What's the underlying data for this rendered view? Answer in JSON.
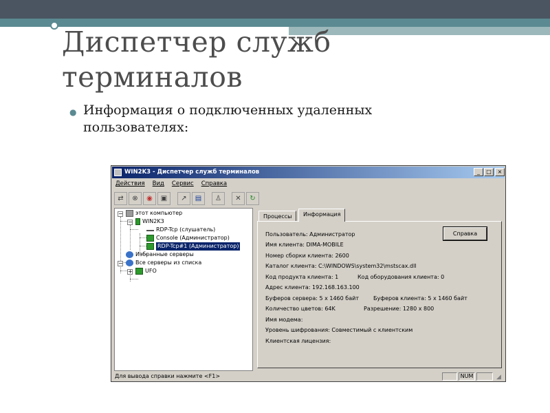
{
  "slide": {
    "title": "Диспетчер служб терминалов",
    "bullet": "Информация о подключенных удаленных пользователях:"
  },
  "window": {
    "title": "WIN2K3 - Диспетчер служб терминалов",
    "controls": {
      "minimize": "_",
      "maximize": "□",
      "close": "×"
    },
    "menu": [
      "Действия",
      "Вид",
      "Сервис",
      "Справка"
    ],
    "toolbar_icons": [
      "connect-icon",
      "disconnect-icon",
      "message-icon",
      "remote-control-icon",
      "reset-icon",
      "status-icon",
      "logoff-icon",
      "end-process-icon",
      "refresh-icon"
    ],
    "tree": {
      "root": "этот компьютер",
      "server": "WIN2K3",
      "sessions": [
        "RDP-Tcp (слушатель)",
        "Console (Администратор)",
        "RDP-Tcp#1 (Администратор)"
      ],
      "favorites": "Избранные серверы",
      "all_servers": "Все серверы из списка",
      "domain": "UFO"
    },
    "tabs": [
      "Процессы",
      "Информация"
    ],
    "active_tab": "Информация",
    "info": {
      "user": "Пользователь: Администратор",
      "client_name": "Имя клиента: DIMA-MOBILE",
      "build": "Номер сборки клиента: 2600",
      "directory": "Каталог клиента: C:\\WINDOWS\\system32\\mstscax.dll",
      "product_id": "Код продукта клиента: 1",
      "hardware_id": "Код оборудования клиента: 0",
      "address": "Адрес клиента: 192.168.163.100",
      "server_buffers": "Буферов сервера: 5 x 1460 байт",
      "client_buffers": "Буферов клиента: 5 x 1460 байт",
      "colors": "Количество цветов: 64K",
      "resolution": "Разрешение: 1280 x 800",
      "modem": "Имя модема:",
      "encryption": "Уровень шифрования: Совместимый с клиентским",
      "license": "Клиентская лицензия:"
    },
    "help_button": "Справка",
    "status": {
      "text": "Для вывода справки нажмите <F1>",
      "num": "NUM"
    }
  }
}
